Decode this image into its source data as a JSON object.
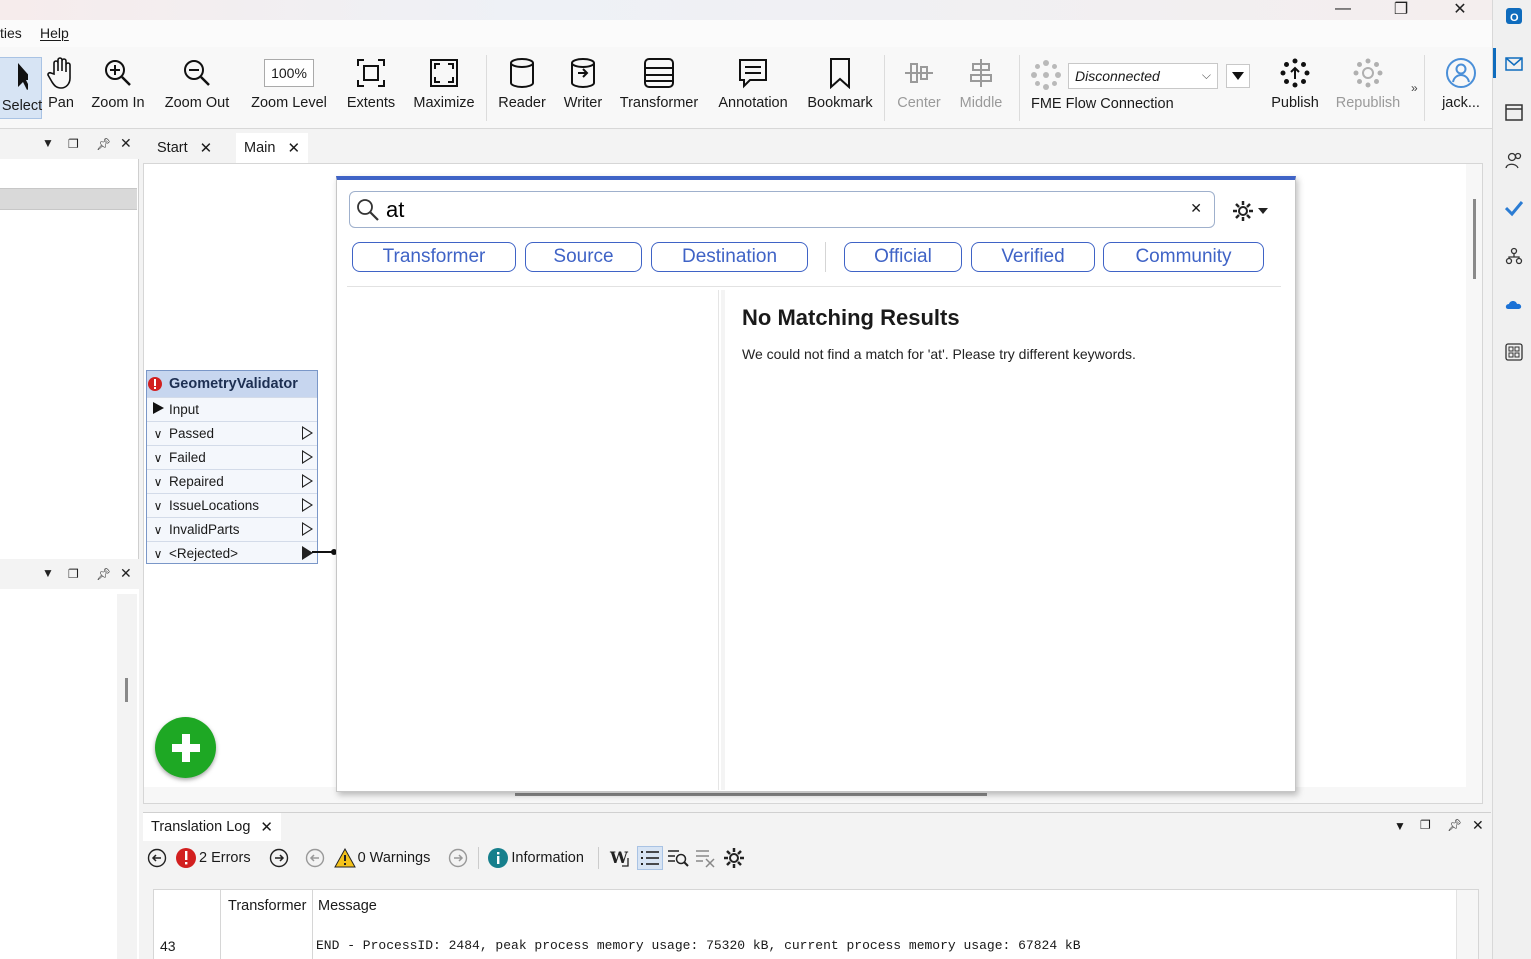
{
  "window": {
    "minimize": "—",
    "restore": "❐",
    "close": "✕"
  },
  "menu": {
    "item1": "ties",
    "item2": "Help"
  },
  "toolbar": {
    "select": "Select",
    "pan": "Pan",
    "zoom_in": "Zoom In",
    "zoom_out": "Zoom Out",
    "zoom_level_value": "100%",
    "zoom_level": "Zoom Level",
    "extents": "Extents",
    "maximize": "Maximize",
    "reader": "Reader",
    "writer": "Writer",
    "transformer": "Transformer",
    "annotation": "Annotation",
    "bookmark": "Bookmark",
    "center": "Center",
    "middle": "Middle",
    "connection_status": "Disconnected",
    "fme_flow_connection": "FME Flow Connection",
    "publish": "Publish",
    "republish": "Republish",
    "overflow": "»",
    "user": "jack..."
  },
  "tabs": [
    {
      "label": "Start"
    },
    {
      "label": "Main"
    }
  ],
  "node": {
    "name": "GeometryValidator",
    "ports": [
      "Input",
      "Passed",
      "Failed",
      "Repaired",
      "IssueLocations",
      "InvalidParts",
      "<Rejected>"
    ]
  },
  "quickadd": {
    "query": "at",
    "filters": [
      "Transformer",
      "Source",
      "Destination",
      "Official",
      "Verified",
      "Community"
    ],
    "no_results_title": "No Matching Results",
    "no_results_message": "We could not find a match for 'at'. Please try different keywords."
  },
  "log": {
    "tab": "Translation Log",
    "errors": "2 Errors",
    "warnings": "0 Warnings",
    "information": "Information",
    "columns": [
      "Transformer",
      "Message"
    ],
    "rows": [
      {
        "line": "43",
        "transformer": "",
        "message": "END - ProcessID: 2484, peak process memory usage: 75320 kB, current process memory usage: 67824 kB"
      }
    ]
  },
  "colors": {
    "accent": "#3f63c6",
    "add_button": "#1ea824",
    "error": "#d21f1f"
  }
}
